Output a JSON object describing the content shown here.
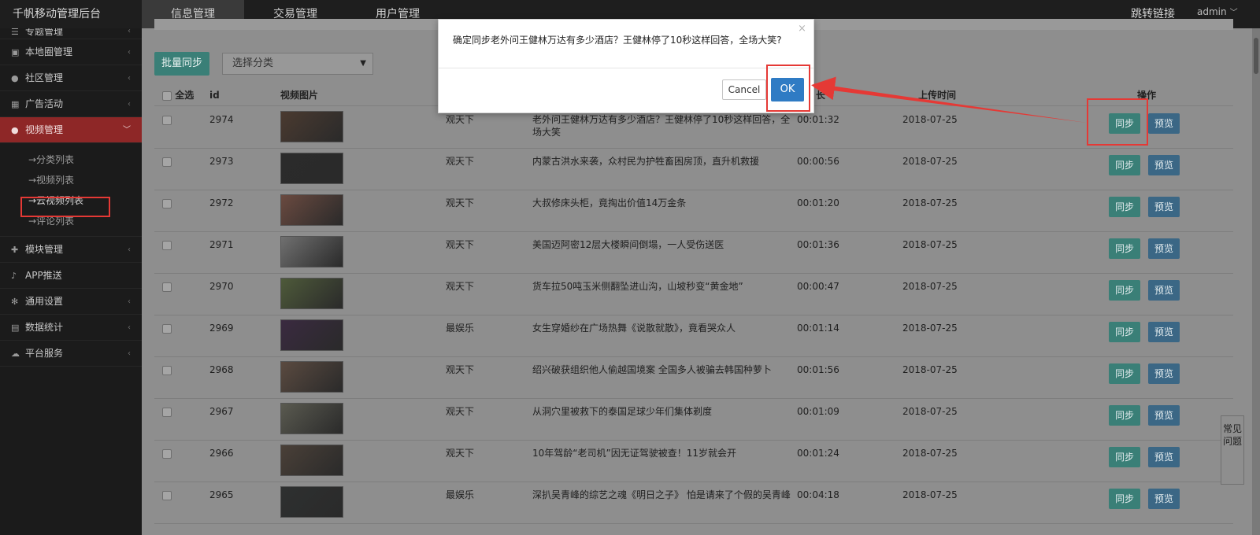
{
  "header": {
    "brand": "千帆移动管理后台",
    "nav": [
      {
        "label": "信息管理",
        "active": true
      },
      {
        "label": "交易管理",
        "active": false
      },
      {
        "label": "用户管理",
        "active": false
      }
    ],
    "jump_link": "跳转链接",
    "user": "admin"
  },
  "sidebar": {
    "items": [
      {
        "label": "专题管理",
        "icon": "list-icon"
      },
      {
        "label": "本地圈管理",
        "icon": "image-icon"
      },
      {
        "label": "社区管理",
        "icon": "users-icon"
      },
      {
        "label": "广告活动",
        "icon": "calendar-icon"
      },
      {
        "label": "视频管理",
        "icon": "users-icon",
        "active": true
      },
      {
        "label": "模块管理",
        "icon": "puzzle-icon"
      },
      {
        "label": "APP推送",
        "icon": "bell-icon"
      },
      {
        "label": "通用设置",
        "icon": "gears-icon"
      },
      {
        "label": "数据统计",
        "icon": "chart-icon"
      },
      {
        "label": "平台服务",
        "icon": "cloud-icon"
      }
    ],
    "video_sub": [
      {
        "label": "→分类列表"
      },
      {
        "label": "→视频列表"
      },
      {
        "label": "→云视频列表",
        "current": true
      },
      {
        "label": "→评论列表"
      }
    ]
  },
  "toolbar": {
    "batch_sync": "批量同步",
    "category_select": "选择分类"
  },
  "table": {
    "headers": {
      "select_all": "全选",
      "id": "id",
      "image": "视频图片",
      "duration_partial": "长",
      "upload_time": "上传时间",
      "actions": "操作"
    },
    "rows": [
      {
        "id": "2974",
        "category": "观天下",
        "title": "老外问王健林万达有多少酒店？王健林停了10秒这样回答，全场大笑",
        "duration": "00:01:32",
        "date": "2018-07-25",
        "thumb_color": "#4a3a30"
      },
      {
        "id": "2973",
        "category": "观天下",
        "title": "内蒙古洪水来袭，众村民为护牲畜困房顶，直升机救援",
        "duration": "00:00:56",
        "date": "2018-07-25",
        "thumb_color": "#2b2b2b"
      },
      {
        "id": "2972",
        "category": "观天下",
        "title": "大叔修床头柜，竟掏出价值14万金条",
        "duration": "00:01:20",
        "date": "2018-07-25",
        "thumb_color": "#6a4a40"
      },
      {
        "id": "2971",
        "category": "观天下",
        "title": "美国迈阿密12层大楼瞬间倒塌，一人受伤送医",
        "duration": "00:01:36",
        "date": "2018-07-25",
        "thumb_color": "#707070"
      },
      {
        "id": "2970",
        "category": "观天下",
        "title": "货车拉50吨玉米侧翻坠进山沟，山坡秒变“黄金地”",
        "duration": "00:00:47",
        "date": "2018-07-25",
        "thumb_color": "#4e5a3a"
      },
      {
        "id": "2969",
        "category": "最娱乐",
        "title": "女生穿婚纱在广场热舞《说散就散》，竟看哭众人",
        "duration": "00:01:14",
        "date": "2018-07-25",
        "thumb_color": "#3a2a40"
      },
      {
        "id": "2968",
        "category": "观天下",
        "title": "绍兴破获组织他人偷越国境案 全国多人被骗去韩国种萝卜",
        "duration": "00:01:56",
        "date": "2018-07-25",
        "thumb_color": "#5a4a40"
      },
      {
        "id": "2967",
        "category": "观天下",
        "title": "从洞穴里被救下的泰国足球少年们集体剃度",
        "duration": "00:01:09",
        "date": "2018-07-25",
        "thumb_color": "#5a5a50"
      },
      {
        "id": "2966",
        "category": "观天下",
        "title": "10年驾龄“老司机”因无证驾驶被查！11岁就会开",
        "duration": "00:01:24",
        "date": "2018-07-25",
        "thumb_color": "#4a4038"
      },
      {
        "id": "2965",
        "category": "最娱乐",
        "title": "深扒吴青峰的综艺之魂《明日之子》 怕是请来了个假的吴青峰",
        "duration": "00:04:18",
        "date": "2018-07-25",
        "thumb_color": "#2e3030"
      }
    ],
    "sync_label": "同步",
    "preview_label": "预览"
  },
  "faq": "常见问题",
  "dialog": {
    "message": "确定同步老外问王健林万达有多少酒店？王健林停了10秒这样回答，全场大笑?",
    "close": "×",
    "cancel": "Cancel",
    "ok": "OK"
  },
  "colors": {
    "annotation_red": "#e53935",
    "ok_blue": "#2f7bc4",
    "sync_teal": "#3a7f77",
    "preview_blue": "#3b6785",
    "active_red": "#8e2727"
  }
}
